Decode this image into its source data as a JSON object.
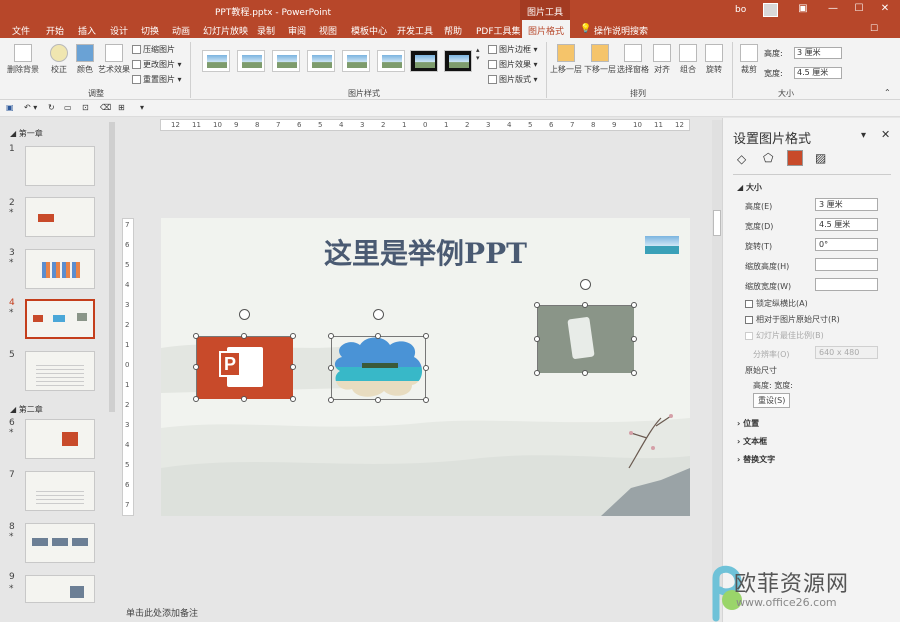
{
  "window": {
    "doc_title": "PPT教程.pptx  -  PowerPoint",
    "tool_tab": "图片工具",
    "user": "bo"
  },
  "tabs": [
    "文件",
    "开始",
    "插入",
    "设计",
    "切换",
    "动画",
    "幻灯片放映",
    "录制",
    "审阅",
    "视图",
    "模板中心",
    "开发工具",
    "帮助",
    "PDF工具集",
    "图片格式",
    "操作说明搜索"
  ],
  "ribbon": {
    "remove_bg": "删除背景",
    "correct": "校正",
    "color": "颜色",
    "art_effect": "艺术效果",
    "compress": "压缩图片",
    "change": "更改图片",
    "reset": "重置图片",
    "group_adjust": "调整",
    "border": "图片边框",
    "effect": "图片效果",
    "layout": "图片版式",
    "group_styles": "图片样式",
    "bring_forward": "上移一层",
    "send_backward": "下移一层",
    "selection_pane": "选择窗格",
    "align": "对齐",
    "group": "组合",
    "rotate": "旋转",
    "group_arrange": "排列",
    "crop": "裁剪",
    "height_label": "高度:",
    "height_val": "3 厘米",
    "width_label": "宽度:",
    "width_val": "4.5 厘米",
    "group_size": "大小"
  },
  "thumbs": {
    "section1": "第一章",
    "section2": "第二章",
    "numbers": [
      "1",
      "2",
      "3",
      "4",
      "5",
      "6",
      "7",
      "8",
      "9"
    ],
    "starred": [
      "*",
      "*",
      "*",
      "*",
      "*"
    ]
  },
  "slide": {
    "title": "这里是举例PPT",
    "ppt_letter": "P"
  },
  "ruler": {
    "h_ticks": [
      "12",
      "11",
      "10",
      "9",
      "8",
      "7",
      "6",
      "5",
      "4",
      "3",
      "2",
      "1",
      "0",
      "1",
      "2",
      "3",
      "4",
      "5",
      "6",
      "7",
      "8",
      "9",
      "10",
      "11",
      "12"
    ],
    "v_ticks": [
      "7",
      "6",
      "5",
      "4",
      "3",
      "2",
      "1",
      "0",
      "1",
      "2",
      "3",
      "4",
      "5",
      "6",
      "7"
    ]
  },
  "panel": {
    "title": "设置图片格式",
    "size_section": "大小",
    "height_label": "高度(E)",
    "height_val": "3 厘米",
    "width_label": "宽度(D)",
    "width_val": "4.5 厘米",
    "rotate_label": "旋转(T)",
    "rotate_val": "0°",
    "scale_h_label": "缩放高度(H)",
    "scale_w_label": "缩放宽度(W)",
    "lock_ratio": "锁定纵横比(A)",
    "relative": "相对于图片原始尺寸(R)",
    "best_scale": "幻灯片最佳比例(B)",
    "resolution_label": "分辨率(O)",
    "resolution_val": "640 x 480",
    "original_size": "原始尺寸",
    "orig_hw": "高度:   宽度:",
    "reset_btn": "重设(S)",
    "position": "位置",
    "textbox": "文本框",
    "alt_text": "替换文字"
  },
  "status": {
    "notes": "单击此处添加备注"
  },
  "watermark": {
    "name": "欧菲资源网",
    "url": "www.office26.com"
  },
  "colors": {
    "accent": "#b7472a",
    "title": "#4a5a72"
  }
}
